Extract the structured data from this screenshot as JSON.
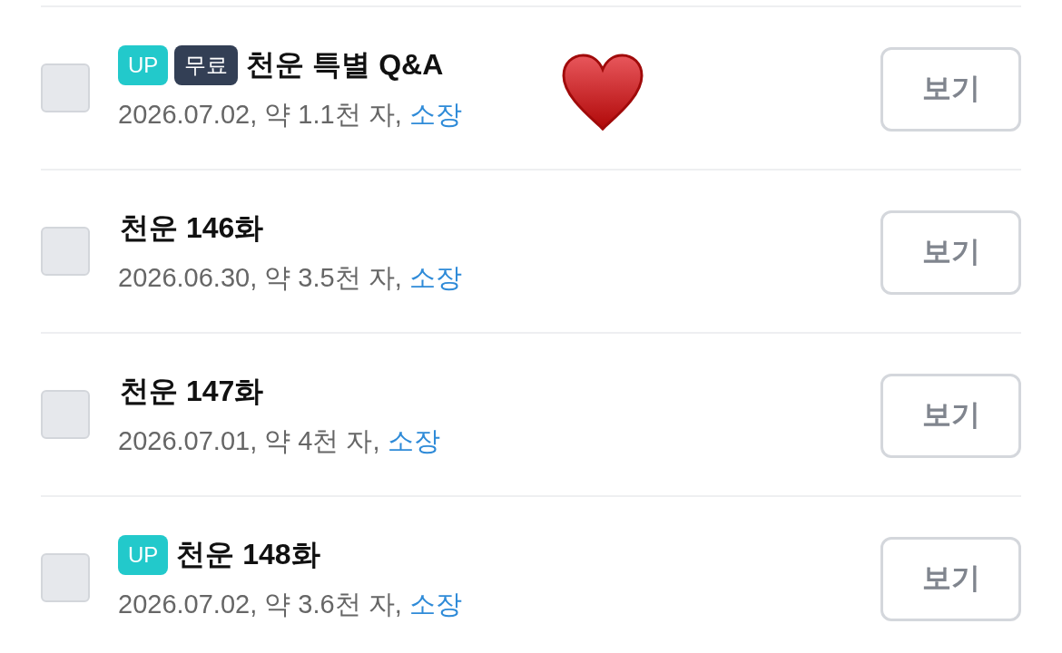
{
  "episodes": [
    {
      "checked": false,
      "badges": [
        {
          "label": "UP",
          "kind": "up"
        },
        {
          "label": "무료",
          "kind": "free"
        }
      ],
      "title": "천운 특별 Q&A",
      "meta": "2026.07.02, 약 1.1천 자,",
      "status": "소장",
      "button": "보기"
    },
    {
      "checked": false,
      "title": "천운 146화",
      "meta": "2026.06.30, 약 3.5천 자,",
      "status": "소장",
      "button": "보기"
    },
    {
      "checked": false,
      "title": "천운 147화",
      "meta": "2026.07.01, 약 4천 자,",
      "status": "소장",
      "button": "보기"
    },
    {
      "checked": false,
      "badges": [
        {
          "label": "UP",
          "kind": "up"
        }
      ],
      "title": "천운 148화",
      "meta": "2026.07.02, 약 3.6천 자,",
      "status": "소장",
      "button": "보기"
    }
  ]
}
